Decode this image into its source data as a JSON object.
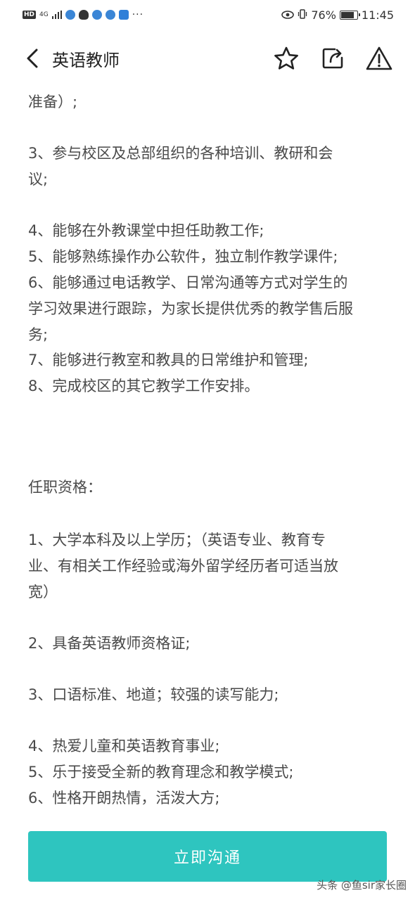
{
  "status_bar": {
    "hd": "HD",
    "network": "4G",
    "dots": "···",
    "battery_text": "76%",
    "time": "11:45"
  },
  "nav": {
    "title": "英语教师",
    "icons": [
      "back-arrow",
      "star",
      "share",
      "report-warning"
    ]
  },
  "content": {
    "lines": [
      "准备）;",
      "3、参与校区及总部组织的各种培训、教研和会",
      "议;",
      "4、能够在外教课堂中担任助教工作;",
      "5、能够熟练操作办公软件，独立制作教学课件;",
      "6、能够通过电话教学、日常沟通等方式对学生的",
      "学习效果进行跟踪，为家长提供优秀的教学售后服",
      "务;",
      "7、能够进行教室和教具的日常维护和管理;",
      "8、完成校区的其它教学工作安排。",
      "任职资格：",
      "1、大学本科及以上学历；（英语专业、教育专",
      "业、有相关工作经验或海外留学经历者可适当放",
      "宽）",
      "2、具备英语教师资格证;",
      "3、口语标准、地道；较强的读写能力;",
      "4、热爱儿童和英语教育事业;",
      "5、乐于接受全新的教育理念和教学模式;",
      "6、性格开朗热情，活泼大方;"
    ]
  },
  "cta": {
    "label": "立即沟通",
    "color": "#2ec5bf"
  },
  "watermark": "头条 @鱼sir家长圈"
}
